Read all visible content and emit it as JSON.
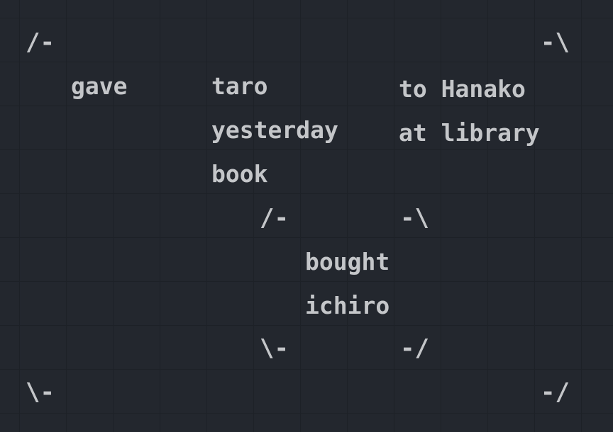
{
  "diagram": {
    "outer": {
      "top_left": "/-",
      "top_right": "-\\",
      "bottom_left": "\\-",
      "bottom_right": "-/"
    },
    "verb": "gave",
    "arguments": [
      "taro",
      "yesterday",
      "book"
    ],
    "modifiers": [
      "to Hanako",
      "at library"
    ],
    "inner": {
      "top_left": "/-",
      "top_right": "-\\",
      "bottom_left": "\\-",
      "bottom_right": "-/",
      "words": [
        "bought",
        "ichiro"
      ]
    }
  }
}
